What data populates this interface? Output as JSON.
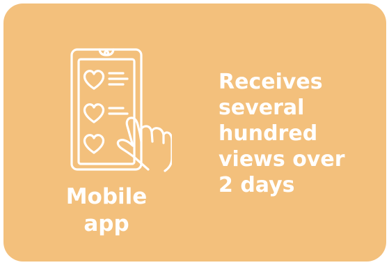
{
  "card": {
    "background_color": "#f3c07c",
    "text_color": "#ffffff",
    "icon": "phone-with-hearts-and-tapping-hand-icon",
    "caption": "Mobile\napp",
    "description": "Receives\nseveral\nhundred\nviews over\n2 days"
  }
}
